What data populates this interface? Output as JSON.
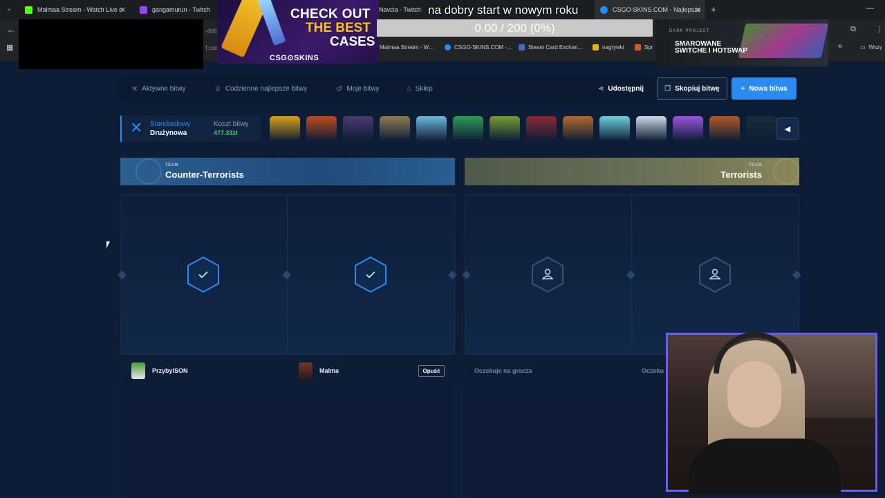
{
  "browser": {
    "tabs": [
      {
        "title": "Malmaa Stream - Watch Live o",
        "color": "#53fc18"
      },
      {
        "title": "gangamurun - Twitch",
        "color": "#9146ff"
      },
      {
        "title": "Navcia - Twitch",
        "color": ""
      },
      {
        "title": "CSGO-SKINS.COM - Najlepsze",
        "color": "#2a8cf0"
      }
    ],
    "new_tab": "+",
    "address_fragment": "-4b5",
    "address_fragment2": "T.com",
    "bookmarks": [
      "Malmaa Stream - W...",
      "CSGO-SKINS.COM -...",
      "Steam Card Exchan...",
      "nagrywki",
      "Spr",
      "Wszy"
    ]
  },
  "overlay": {
    "promo": {
      "line1": "CHECK OUT",
      "line2": "THE BEST",
      "line3": "CASES",
      "brand": "CSG⊙SKINS"
    },
    "goal_title": "na dobry start w nowym roku",
    "goal_text": "0.00 / 200 (0%)",
    "goal_fraction": 0,
    "keyboard_ad": {
      "brand": "DARK PROJECT",
      "line1": "SMAROWANE",
      "line2": "SWITCHE I HOTSWAP"
    }
  },
  "nav": {
    "items": [
      {
        "label": "Aktywne bitwy",
        "icon": "crossed-swords-icon"
      },
      {
        "label": "Codzienne najlepsze bitwy",
        "icon": "trophy-icon"
      },
      {
        "label": "Moje bitwy",
        "icon": "history-icon"
      },
      {
        "label": "Sklep",
        "icon": "shop-icon"
      }
    ],
    "share_label": "Udostępnij",
    "copy_label": "Skopiuj bitwę",
    "new_label": "Nowa bitwa"
  },
  "battle": {
    "mode_type": "Standardowy",
    "mode_name": "Drużynowa",
    "cost_label": "Koszt bitwy",
    "cost_value": "477.33zł",
    "case_colors": [
      "#d8a21c",
      "#c04a1e",
      "#4a3a6e",
      "#8f7a52",
      "#6fb8e0",
      "#2f9a55",
      "#7a9a3a",
      "#8a2a35",
      "#b06a2f",
      "#6fd0e0",
      "#d0d8e8",
      "#9a55e0",
      "#b05a2a",
      "#2f4a3a"
    ]
  },
  "teams": {
    "ct": {
      "sub": "TEAM",
      "name": "Counter-Terrorists"
    },
    "t": {
      "sub": "TEAM",
      "name": "Terrorists"
    }
  },
  "players": [
    {
      "name": "PrzybylSON"
    },
    {
      "name": "Malma",
      "action": "Opuść"
    }
  ],
  "waiting_label": "Oczekuje na gracza",
  "waiting_label_cut": "Oczeku"
}
